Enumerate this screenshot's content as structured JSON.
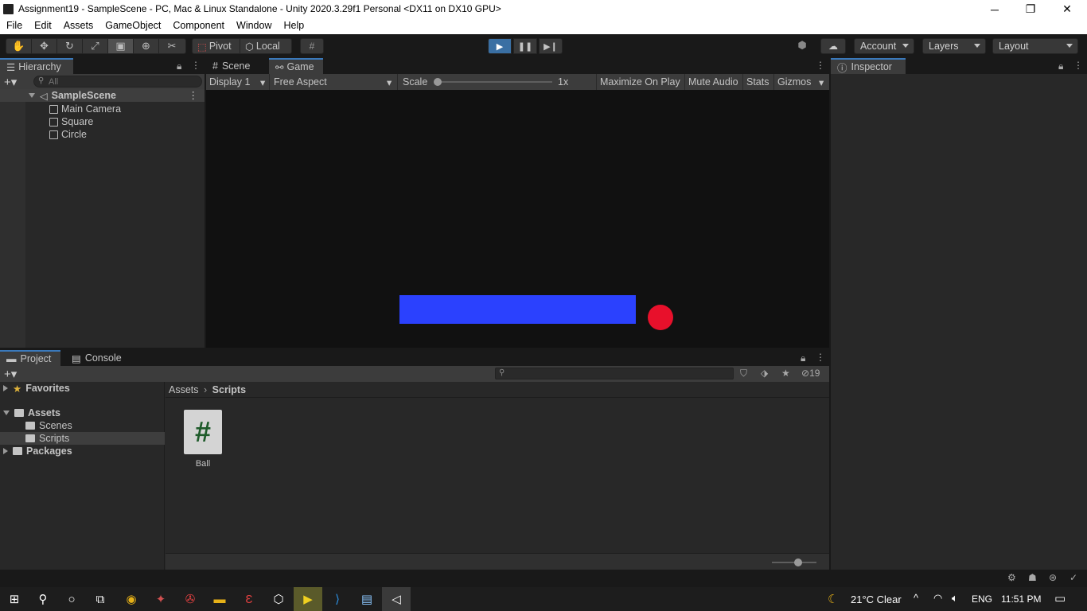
{
  "window": {
    "title": "Assignment19 - SampleScene - PC, Mac & Linux Standalone - Unity 2020.3.29f1 Personal <DX11 on DX10 GPU>",
    "minimize": "─",
    "restore": "❐",
    "close": "✕"
  },
  "menu": [
    "File",
    "Edit",
    "Assets",
    "GameObject",
    "Component",
    "Window",
    "Help"
  ],
  "toolbar": {
    "pivot": "Pivot",
    "local": "Local",
    "account": "Account",
    "layers": "Layers",
    "layout": "Layout"
  },
  "hierarchy": {
    "tab": "Hierarchy",
    "search_placeholder": "All",
    "scene": "SampleScene",
    "objects": [
      "Main Camera",
      "Square",
      "Circle"
    ]
  },
  "game_view": {
    "tabs": [
      "Scene",
      "Game"
    ],
    "display": "Display 1",
    "aspect": "Free Aspect",
    "scale_label": "Scale",
    "scale_value": "1x",
    "maximize": "Maximize On Play",
    "mute": "Mute Audio",
    "stats": "Stats",
    "gizmos": "Gizmos",
    "square_color": "#2b41fe",
    "circle_color": "#e8102b",
    "background": "#111111"
  },
  "inspector": {
    "tab": "Inspector"
  },
  "project": {
    "tabs": [
      "Project",
      "Console"
    ],
    "hidden_count": "19",
    "favorites": "Favorites",
    "assets": "Assets",
    "assets_children": [
      "Scenes",
      "Scripts"
    ],
    "packages": "Packages",
    "breadcrumb": [
      "Assets",
      "Scripts"
    ],
    "files": [
      {
        "name": "Ball",
        "glyph": "#"
      }
    ]
  },
  "taskbar": {
    "weather": "21°C  Clear",
    "language": "ENG",
    "time": "11:51 PM"
  }
}
